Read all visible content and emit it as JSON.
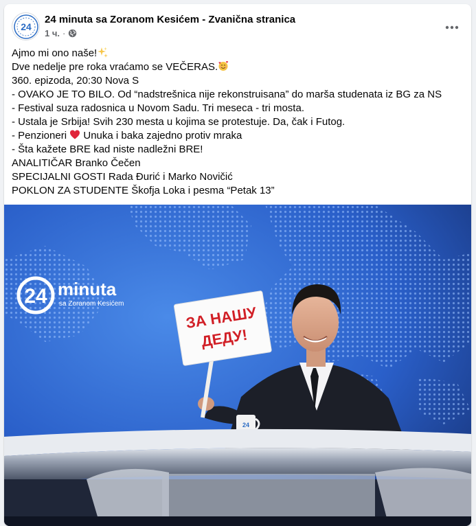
{
  "post": {
    "page_name": "24 minuta sa Zoranom Kesićem - Zvanična stranica",
    "time": "1 ч.",
    "separator": "·",
    "privacy_icon": "globe-icon",
    "more_icon": "more-horizontal-icon",
    "avatar_text": "24",
    "lines": [
      {
        "text": "Ajmo mi ono naše!",
        "emoji": "sparkles-icon"
      },
      {
        "text": "Dve nedelje pre roka vraćamo se VEČERAS.",
        "emoji": "smiling-face-with-hearts-icon"
      },
      {
        "text": "360. epizoda, 20:30 Nova S"
      },
      {
        "text": "- OVAKO JE TO BILO. Od “nadstrešnica nije rekonstruisana” do marša studenata iz BG za NS"
      },
      {
        "text": "- Festival suza  radosnica u Novom Sadu. Tri meseca - tri mosta."
      },
      {
        "text": "- Ustala je Srbija! Svih 230 mesta u kojima se protestuje. Da, čak i Futog."
      },
      {
        "prefix": "- Penzioneri ",
        "emoji": "red-heart-icon",
        "text": " Unuka i baka zajedno protiv mraka"
      },
      {
        "text": "- Šta kažete BRE kad niste nadležni BRE!"
      },
      {
        "text": "ANALITIČAR Branko Čečen"
      },
      {
        "text": "SPECIJALNI GOSTI Rada Đurić i Marko Novičić"
      },
      {
        "text": "POKLON ZA STUDENTE Škofja Loka i pesma “Petak 13”"
      }
    ]
  },
  "photo": {
    "logo_number": "24",
    "logo_word": "minuta",
    "logo_sub": "sa Zoranom Kesićem",
    "sign_line1": "ЗА НАШУ",
    "sign_line2": "ДЕДУ!",
    "mug_text": "24"
  },
  "colors": {
    "studio_blue": "#2f6ad1",
    "studio_dark": "#17306e",
    "text_secondary": "#65676b"
  }
}
